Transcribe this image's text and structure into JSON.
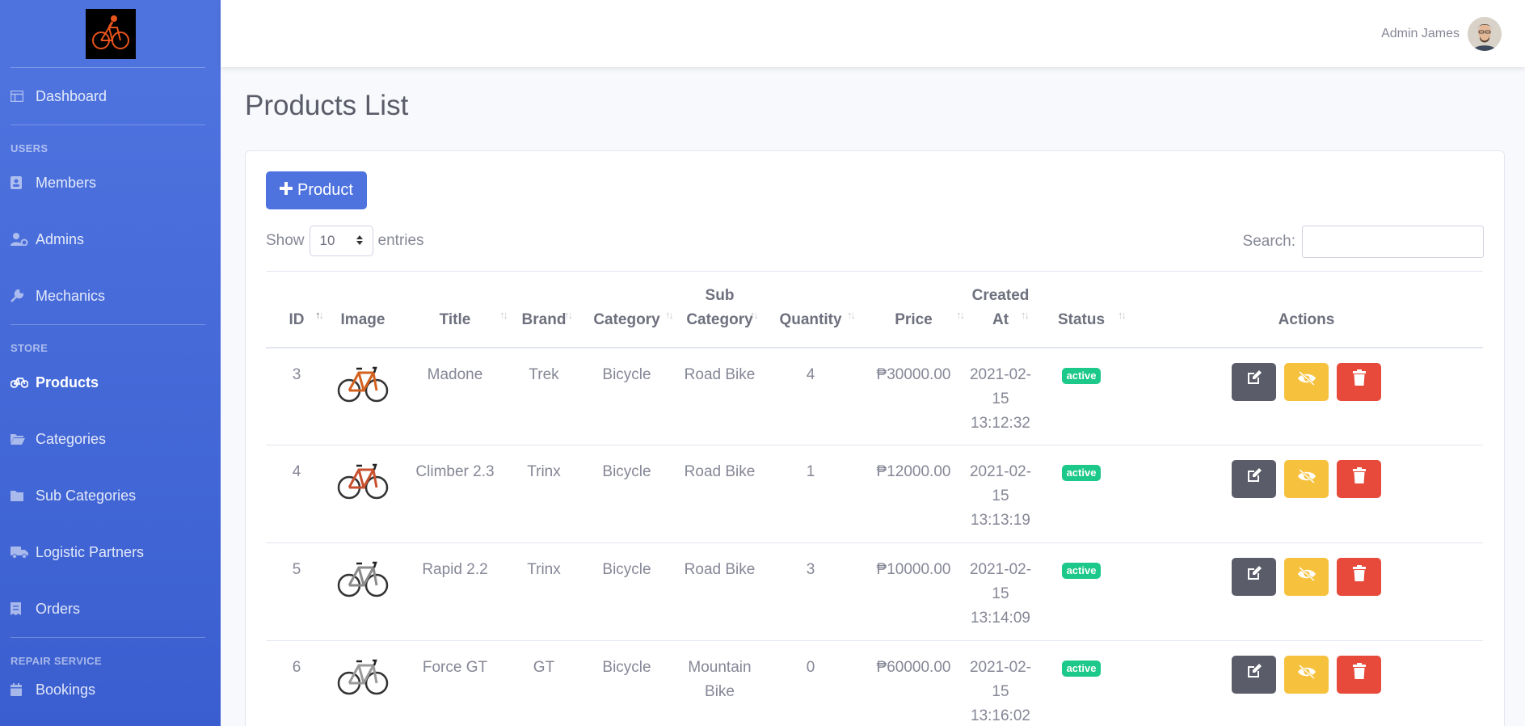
{
  "topbar": {
    "user_name": "Admin James"
  },
  "sidebar": {
    "dashboard": "Dashboard",
    "headings": {
      "users": "USERS",
      "store": "STORE",
      "repair": "REPAIR SERVICE"
    },
    "items": {
      "members": "Members",
      "admins": "Admins",
      "mechanics": "Mechanics",
      "products": "Products",
      "categories": "Categories",
      "sub_categories": "Sub Categories",
      "logistic": "Logistic Partners",
      "orders": "Orders",
      "bookings": "Bookings"
    },
    "active": "Products"
  },
  "page": {
    "title": "Products List"
  },
  "toolbar": {
    "add_label": "Product",
    "show_label": "Show",
    "entries_value": "10",
    "entries_label": "entries",
    "search_label": "Search:",
    "search_value": ""
  },
  "table": {
    "headers": {
      "id": "ID",
      "image": "Image",
      "title": "Title",
      "brand": "Brand",
      "category": "Category",
      "sub_category_1": "Sub",
      "sub_category_2": "Category",
      "quantity": "Quantity",
      "price": "Price",
      "created_1": "Created",
      "created_2": "At",
      "status": "Status",
      "actions": "Actions"
    },
    "rows": [
      {
        "id": "3",
        "title": "Madone",
        "brand": "Trek",
        "category": "Bicycle",
        "sub_category": "Road Bike",
        "sub_category_2": "",
        "quantity": "4",
        "price": "₱30000.00",
        "date": "2021-02-",
        "date2": "15",
        "time": "13:12:32",
        "status": "active",
        "bike_color": "#d4621f"
      },
      {
        "id": "4",
        "title": "Climber 2.3",
        "brand": "Trinx",
        "category": "Bicycle",
        "sub_category": "Road Bike",
        "sub_category_2": "",
        "quantity": "1",
        "price": "₱12000.00",
        "date": "2021-02-",
        "date2": "15",
        "time": "13:13:19",
        "status": "active",
        "bike_color": "#c8502e"
      },
      {
        "id": "5",
        "title": "Rapid 2.2",
        "brand": "Trinx",
        "category": "Bicycle",
        "sub_category": "Road Bike",
        "sub_category_2": "",
        "quantity": "3",
        "price": "₱10000.00",
        "date": "2021-02-",
        "date2": "15",
        "time": "13:14:09",
        "status": "active",
        "bike_color": "#8a8a8a"
      },
      {
        "id": "6",
        "title": "Force GT",
        "brand": "GT",
        "category": "Bicycle",
        "sub_category": "Mountain",
        "sub_category_2": "Bike",
        "quantity": "0",
        "price": "₱60000.00",
        "date": "2021-02-",
        "date2": "15",
        "time": "13:16:02",
        "status": "active",
        "bike_color": "#9a9a9a"
      }
    ]
  },
  "colors": {
    "primary": "#4e73df",
    "success": "#1cc88a",
    "warning": "#f6c23e",
    "danger": "#e74a3b",
    "dark": "#5a5c69"
  }
}
